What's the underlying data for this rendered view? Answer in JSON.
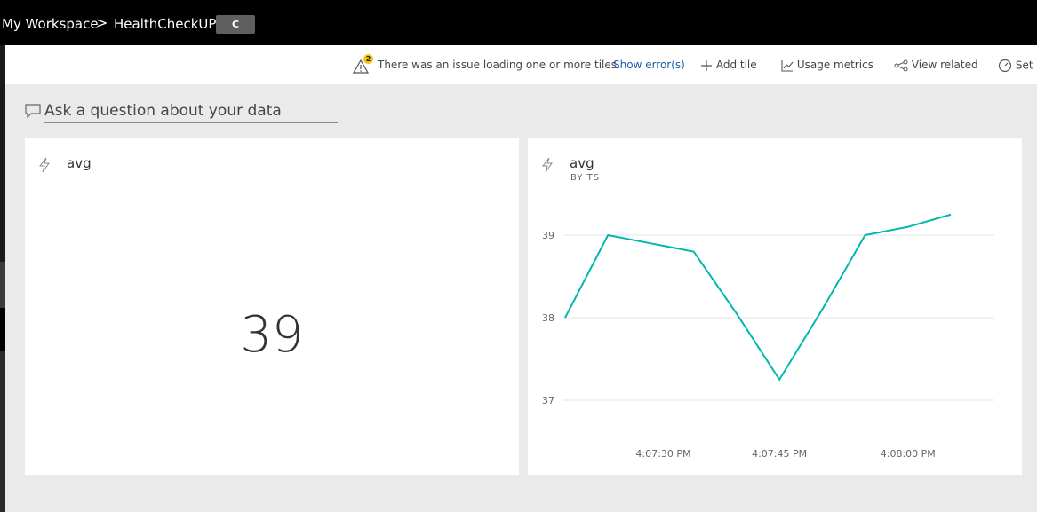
{
  "breadcrumb": {
    "workspace": "My Workspace",
    "separator": ">",
    "dashboard": "HealthCheckUP",
    "badge": "C"
  },
  "actions": {
    "warning_count": "2",
    "issue_text": "There was an issue loading one or more tiles.",
    "show_errors": "Show error(s)",
    "add_tile": "Add tile",
    "usage_metrics": "Usage metrics",
    "view_related": "View related",
    "settings": "Set"
  },
  "qa": {
    "placeholder": "Ask a question about your data"
  },
  "tiles": [
    {
      "title": "avg",
      "value": "39"
    },
    {
      "title": "avg",
      "subtitle": "BY TS"
    }
  ],
  "colors": {
    "line": "#01b8aa",
    "warning": "#f2c811",
    "link": "#1d5ea8"
  },
  "icons": [
    "warning-icon",
    "plus-icon",
    "line-chart-icon",
    "share-nodes-icon",
    "gauge-icon",
    "comment-icon",
    "lightning-icon"
  ],
  "chart_data": {
    "type": "line",
    "x": [
      "4:07:20 PM",
      "4:07:25 PM",
      "4:07:30 PM",
      "4:07:35 PM",
      "4:07:40 PM",
      "4:07:45 PM",
      "4:07:50 PM",
      "4:07:55 PM",
      "4:08:00 PM",
      "4:08:05 PM"
    ],
    "values": [
      38.0,
      39.0,
      38.9,
      38.8,
      38.05,
      37.25,
      38.1,
      39.0,
      39.1,
      39.25
    ],
    "yticks": [
      "37",
      "38",
      "39"
    ],
    "xticks": [
      "4:07:30 PM",
      "4:07:45 PM",
      "4:08:00 PM"
    ],
    "ylim": [
      37,
      39.5
    ],
    "grid": true,
    "title": "avg",
    "subtitle": "BY TS"
  }
}
